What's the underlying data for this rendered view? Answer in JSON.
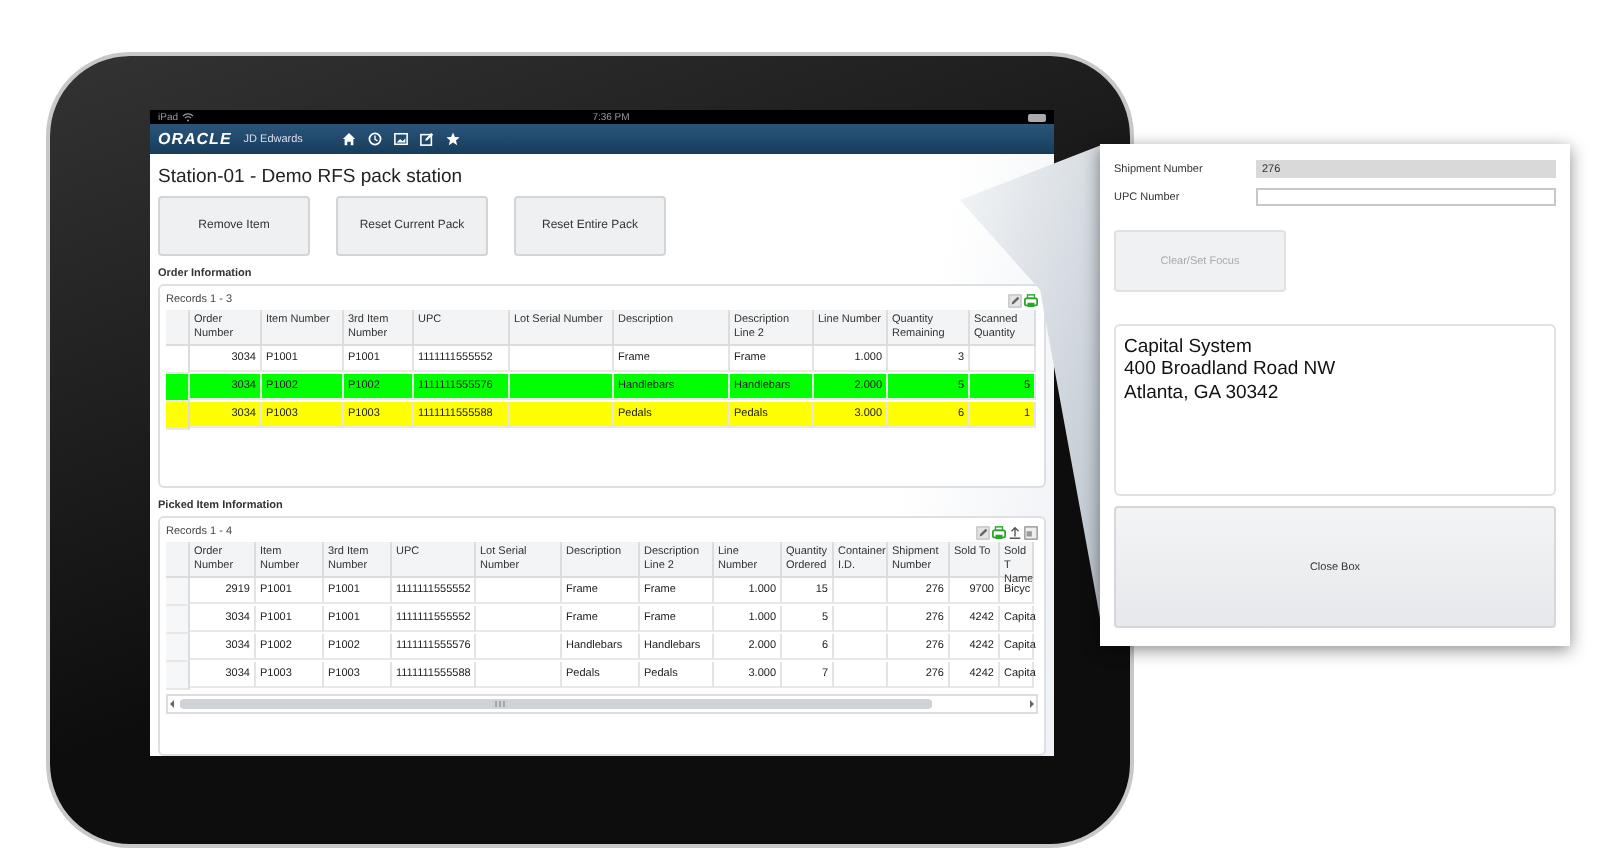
{
  "device_status": {
    "carrier": "iPad",
    "time": "7:36 PM"
  },
  "app_header": {
    "logo": "ORACLE",
    "product": "JD Edwards"
  },
  "page_title": "Station-01 - Demo RFS pack station",
  "action_buttons": [
    "Remove Item",
    "Reset Current Pack",
    "Reset Entire Pack"
  ],
  "order_information": {
    "heading": "Order Information",
    "records": "Records 1 - 3",
    "columns": [
      "Order Number",
      "Item Number",
      "3rd Item Number",
      "UPC",
      "Lot Serial Number",
      "Description",
      "Description Line 2",
      "Line Number",
      "Quantity Remaining",
      "Scanned Quantity"
    ],
    "rows": [
      {
        "color": "#ffffff",
        "cells": [
          "3034",
          "P1001",
          "P1001",
          "1111111555552",
          "",
          "Frame",
          "Frame",
          "1.000",
          "3",
          ""
        ]
      },
      {
        "color": "#00ff00",
        "cells": [
          "3034",
          "P1002",
          "P1002",
          "1111111555576",
          "",
          "Handlebars",
          "Handlebars",
          "2.000",
          "5",
          "5"
        ]
      },
      {
        "color": "#ffff00",
        "cells": [
          "3034",
          "P1003",
          "P1003",
          "1111111555588",
          "",
          "Pedals",
          "Pedals",
          "3.000",
          "6",
          "1"
        ]
      }
    ]
  },
  "picked_item_information": {
    "heading": "Picked Item Information",
    "records": "Records 1 - 4",
    "columns": [
      "Order Number",
      "Item Number",
      "3rd Item Number",
      "UPC",
      "Lot Serial Number",
      "Description",
      "Description Line 2",
      "Line Number",
      "Quantity Ordered",
      "Container I.D.",
      "Shipment Number",
      "Sold To",
      "Sold T Name"
    ],
    "rows": [
      {
        "cells": [
          "2919",
          "P1001",
          "P1001",
          "1111111555552",
          "",
          "Frame",
          "Frame",
          "1.000",
          "15",
          "",
          "276",
          "9700",
          "Bicyc"
        ]
      },
      {
        "cells": [
          "3034",
          "P1001",
          "P1001",
          "1111111555552",
          "",
          "Frame",
          "Frame",
          "1.000",
          "5",
          "",
          "276",
          "4242",
          "Capita"
        ]
      },
      {
        "cells": [
          "3034",
          "P1002",
          "P1002",
          "1111111555576",
          "",
          "Handlebars",
          "Handlebars",
          "2.000",
          "6",
          "",
          "276",
          "4242",
          "Capita"
        ]
      },
      {
        "cells": [
          "3034",
          "P1003",
          "P1003",
          "1111111555588",
          "",
          "Pedals",
          "Pedals",
          "3.000",
          "7",
          "",
          "276",
          "4242",
          "Capita"
        ]
      }
    ]
  },
  "pack_panel": {
    "fields": [
      {
        "label": "Shipment Number",
        "value": "276",
        "readonly": true
      },
      {
        "label": "UPC Number",
        "readonly": false
      }
    ],
    "clear_button": {
      "label": "Clear/Set Focus",
      "disabled": true
    },
    "address": [
      "Capital System",
      "400 Broadland Road NW",
      "Atlanta, GA 30342"
    ],
    "close_button": "Close Box"
  }
}
